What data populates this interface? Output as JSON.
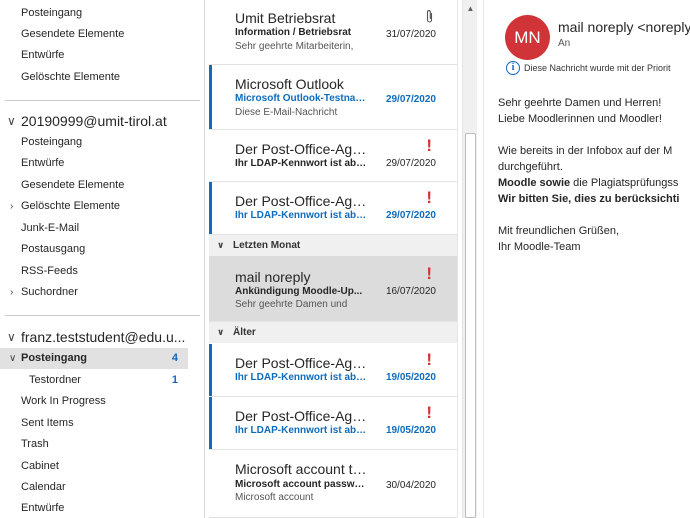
{
  "folders_top": [
    {
      "label": "Posteingang"
    },
    {
      "label": "Gesendete Elemente"
    },
    {
      "label": "Entwürfe"
    },
    {
      "label": "Gelöschte Elemente"
    }
  ],
  "account1": {
    "name": "20190999@umit-tirol.at",
    "folders": [
      {
        "label": "Posteingang"
      },
      {
        "label": "Entwürfe"
      },
      {
        "label": "Gesendete Elemente"
      },
      {
        "label": "Gelöschte Elemente"
      },
      {
        "label": "Junk-E-Mail"
      },
      {
        "label": "Postausgang"
      },
      {
        "label": "RSS-Feeds"
      },
      {
        "label": "Suchordner"
      }
    ]
  },
  "account2": {
    "name": "franz.teststudent@edu.u...",
    "folders": [
      {
        "label": "Posteingang",
        "count": "4"
      },
      {
        "label": "Testordner",
        "count": "1"
      },
      {
        "label": "Work In Progress"
      },
      {
        "label": "Sent Items"
      },
      {
        "label": "Trash"
      },
      {
        "label": "Cabinet"
      },
      {
        "label": "Calendar"
      },
      {
        "label": "Entwürfe"
      }
    ]
  },
  "messages": [
    {
      "sender": "Umit Betriebsrat",
      "subject": "Information / Betriebsrat",
      "preview": "Sehr geehrte Mitarbeiterin,",
      "date": "31/07/2020",
      "unread": false,
      "attachment": true
    },
    {
      "sender": "Microsoft Outlook",
      "subject": "Microsoft Outlook-Testnac...",
      "preview": "Diese E-Mail-Nachricht",
      "date": "29/07/2020",
      "unread": true
    },
    {
      "sender": "Der Post-Office-Age...",
      "subject": "Ihr LDAP-Kennwort ist abg...",
      "date": "29/07/2020",
      "unread": false,
      "important": true
    },
    {
      "sender": "Der Post-Office-Age...",
      "subject": "Ihr LDAP-Kennwort ist abg...",
      "date": "29/07/2020",
      "unread": true,
      "important": true
    }
  ],
  "group_last_month": "Letzten Monat",
  "messages_last_month": [
    {
      "sender": "mail noreply",
      "subject": "Ankündigung Moodle-Up...",
      "preview": "Sehr geehrte Damen und",
      "date": "16/07/2020",
      "unread": false,
      "important": true,
      "selected": true
    }
  ],
  "group_older": "Älter",
  "messages_older": [
    {
      "sender": "Der Post-Office-Age...",
      "subject": "Ihr LDAP-Kennwort ist abg...",
      "date": "19/05/2020",
      "unread": true,
      "important": true
    },
    {
      "sender": "Der Post-Office-Age...",
      "subject": "Ihr LDAP-Kennwort ist abg...",
      "date": "19/05/2020",
      "unread": true,
      "important": true
    },
    {
      "sender": "Microsoft account te...",
      "subject": "Microsoft account passwor...",
      "preview": "Microsoft account",
      "date": "30/04/2020",
      "unread": false
    }
  ],
  "reading": {
    "avatar_initials": "MN",
    "avatar_color": "#d13438",
    "from": "mail noreply <noreply",
    "to_label": "An",
    "info_text": "Diese Nachricht wurde mit der Priorit",
    "body": {
      "line1": "Sehr geehrte Damen und Herren!",
      "line2": "Liebe Moodlerinnen und Moodler!",
      "line3": "Wie bereits in der Infobox auf der M",
      "line4": "durchgeführt.",
      "line5_bold": "Moodle sowie",
      "line5_rest": " die Plagiatsprüfungss",
      "line6": "Wir bitten Sie, dies zu berücksichti",
      "line7": "Mit freundlichen Grüßen,",
      "line8": "Ihr Moodle-Team"
    }
  },
  "colors": {
    "accent": "#0f6cbd",
    "flag": "#d13438",
    "selected": "#dcdcdc"
  }
}
